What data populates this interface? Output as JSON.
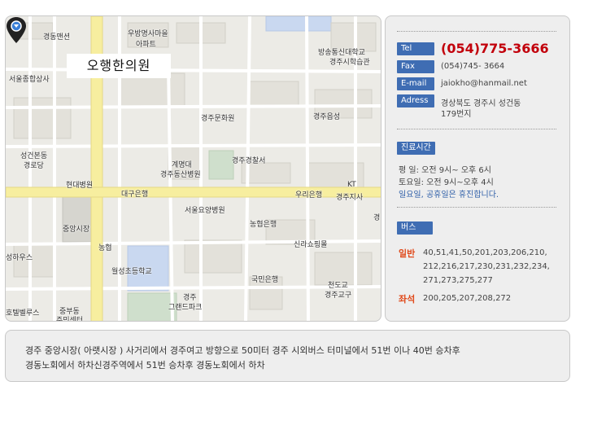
{
  "map": {
    "clinic_label": "오행한의원",
    "labels": {
      "kyungdong_mansion": "경동맨션",
      "woobang_1": "우방명사마을",
      "woobang_2": "아파트",
      "broadcast_1": "방송통신대학교",
      "broadcast_2": "경주시학습관",
      "seoul_general": "서울종합상사",
      "culture_center": "경주문화원",
      "eupseong": "경주읍성",
      "seonggeon_1": "성건본동",
      "seonggeon_2": "경로당",
      "keimyung_1": "계명대",
      "keimyung_2": "경주동산병원",
      "police": "경주경찰서",
      "hyundai_hospital": "현대병원",
      "daegu_bank": "대구은행",
      "woori_bank": "우리은행",
      "kt_1": "KT",
      "kt_2": "경주지사",
      "seoul_nursing": "서울요양병원",
      "central_market": "중앙시장",
      "nonghyup_bank": "농협은행",
      "gyeong": "경",
      "nonghyup": "농협",
      "silla_shopping": "신라쇼핑몰",
      "house": "성하우스",
      "wolseong_school": "월성초등학교",
      "kookmin_bank": "국민은행",
      "cheondogyo_1": "천도교",
      "cheondogyo_2": "경주교구",
      "grand_park_1": "경주",
      "grand_park_2": "그랜드파크",
      "hotel_bellus": "호텔벨루스",
      "jungbu_1": "중부동",
      "jungbu_2": "주민센터"
    }
  },
  "info": {
    "tel_label": "Tel",
    "tel_value": "(054)775-3666",
    "fax_label": "Fax",
    "fax_value": "(054)745- 3664",
    "email_label": "E-mail",
    "email_value": "jaiokho@hanmail.net",
    "address_label": "Adress",
    "address_line1": "경상북도 경주시 성건동",
    "address_line2": "179번지",
    "hours_label": "진료시간",
    "weekday": "평    일: 오전 9시~ 오후 6시",
    "saturday": "토요일: 오전 9시~오후 4시",
    "holiday": "일요일, 공휴일은 휴진합니다.",
    "bus_label": "버스",
    "general_label": "일반",
    "general_line1": "40,51,41,50,201,203,206,210,",
    "general_line2": "212,216,217,230,231,232,234,",
    "general_line3": "271,273,275,277",
    "seat_label": "좌석",
    "seat_line": "200,205,207,208,272"
  },
  "directions": {
    "line1": "경주 중앙시장( 아랫시장 ) 사거리에서 경주여고 방향으로 50미터 경주 시외버스 터미널에서 51번 이나 40번 승차후",
    "line2": "경동노회에서 하차신경주역에서 51번 승차후 경동노회에서 하차"
  }
}
